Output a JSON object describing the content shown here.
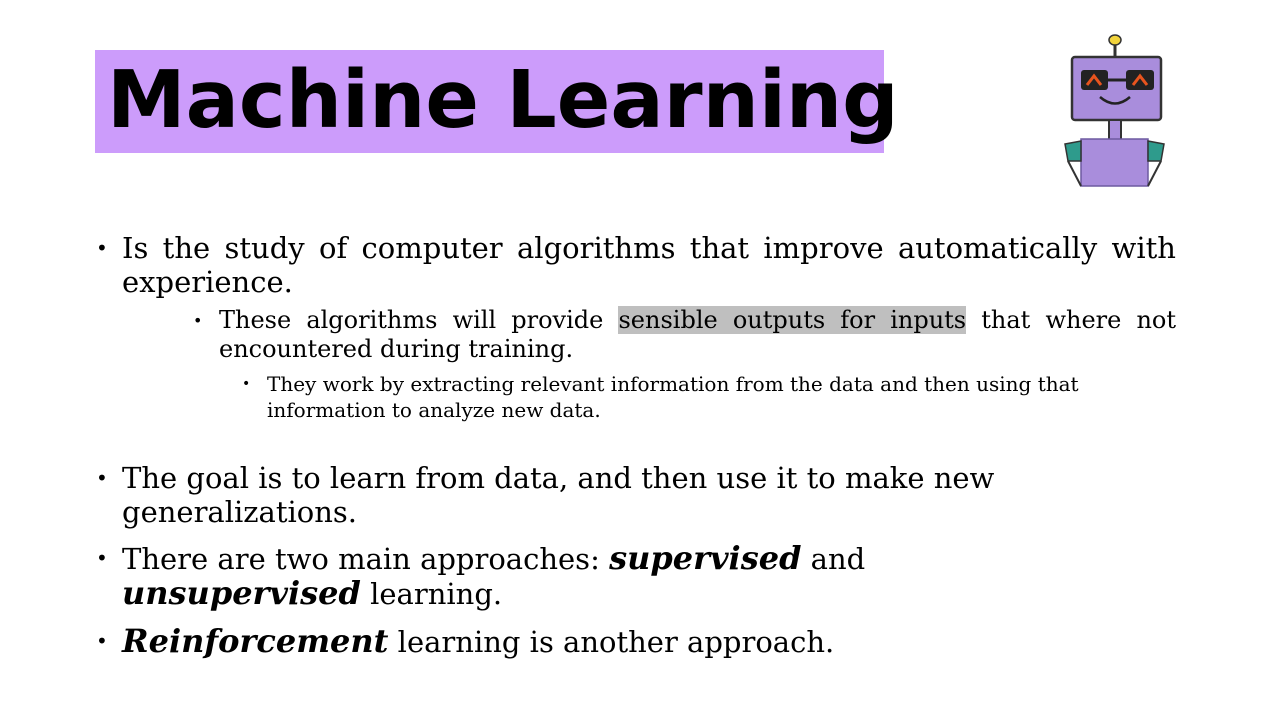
{
  "slide": {
    "title": "Machine Learning",
    "bullets": {
      "b1": "Is the study of computer algorithms that improve automatically with experience.",
      "b1_1_before": "These algorithms will provide ",
      "b1_1_highlight": "sensible outputs for inputs",
      "b1_1_after": " that where not encountered during training.",
      "b1_1_1": "They work by extracting relevant information from the data and then using that information to analyze new data.",
      "b2": "The goal is to learn from data, and then use it to make new generalizations.",
      "b3_before": "There are two main approaches: ",
      "b3_emph1": "supervised",
      "b3_mid": " and ",
      "b3_emph2": "unsupervised",
      "b3_after": " learning.",
      "b4_emph": "Reinforcement",
      "b4_after": " learning is another approach."
    }
  },
  "bullet_glyph": "•",
  "colors": {
    "title_band": "#cc9cfb",
    "highlight": "#bfbfbf",
    "robot_body": "#a98ddc",
    "robot_eyes": "#e8541e",
    "robot_arm": "#2e9b8c",
    "robot_antenna": "#f2d43c"
  },
  "icons": {
    "mascot": "robot-icon"
  }
}
